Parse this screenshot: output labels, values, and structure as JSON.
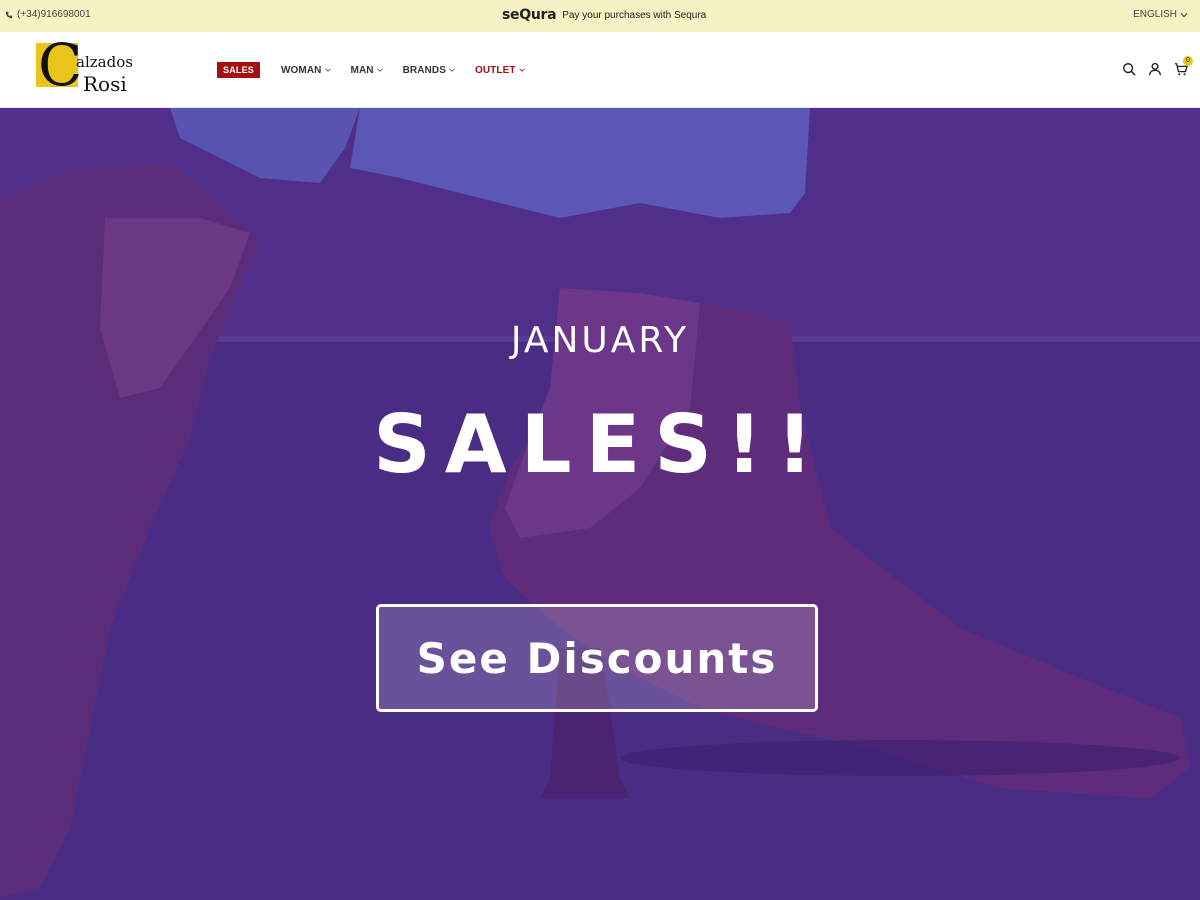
{
  "topbar": {
    "phone": "(+34)916698001",
    "promo_brand": "seQura",
    "promo_text": "Pay your purchases with Sequra",
    "language": "ENGLISH"
  },
  "header": {
    "logo": {
      "letter": "C",
      "line1": "alzados",
      "line2": "Rosi"
    },
    "nav": {
      "sales_badge": "SALES",
      "items": [
        {
          "label": "WOMAN"
        },
        {
          "label": "MAN"
        },
        {
          "label": "BRANDS"
        },
        {
          "label": "OUTLET"
        }
      ]
    },
    "cart_count": "0"
  },
  "hero": {
    "subtitle": "JANUARY",
    "title": "SALES!!",
    "cta": "See Discounts",
    "overlay_color": "#4e2f89"
  },
  "colors": {
    "accent_red": "#a3100f",
    "brand_yellow": "#e7c619",
    "topbar_bg": "#f7f1c6"
  }
}
